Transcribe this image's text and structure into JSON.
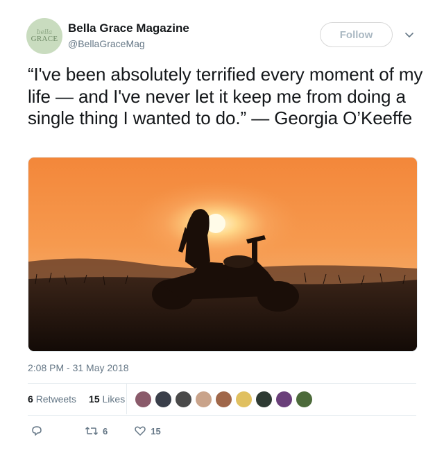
{
  "account": {
    "name": "Bella Grace Magazine",
    "handle": "@BellaGraceMag",
    "avatar_text_1": "bella",
    "avatar_text_2": "GRACE"
  },
  "follow_button": {
    "label": "Follow"
  },
  "tweet": {
    "text": "“I've been absolutely terrified every moment of my life — and I've never let it keep me from doing a single thing I wanted to do.” — Georgia O’Keeffe",
    "timestamp": "2:08 PM - 31 May 2018"
  },
  "stats": {
    "retweets_count": "6",
    "retweets_label": "Retweets",
    "likes_count": "15",
    "likes_label": "Likes"
  },
  "likers": [
    {
      "color": "#8a5a6a"
    },
    {
      "color": "#3a3f4a"
    },
    {
      "color": "#4a4a4a"
    },
    {
      "color": "#c9a38a"
    },
    {
      "color": "#a0674a"
    },
    {
      "color": "#e0c060"
    },
    {
      "color": "#2e3a33"
    },
    {
      "color": "#6a3f7a"
    },
    {
      "color": "#4c6a3a"
    }
  ],
  "actions": {
    "reply_icon": "reply-icon",
    "retweet_icon": "retweet-icon",
    "retweet_count": "6",
    "like_icon": "heart-icon",
    "like_count": "15"
  },
  "colors": {
    "text": "#14171a",
    "muted": "#657786",
    "divider": "#e6ecf0"
  }
}
